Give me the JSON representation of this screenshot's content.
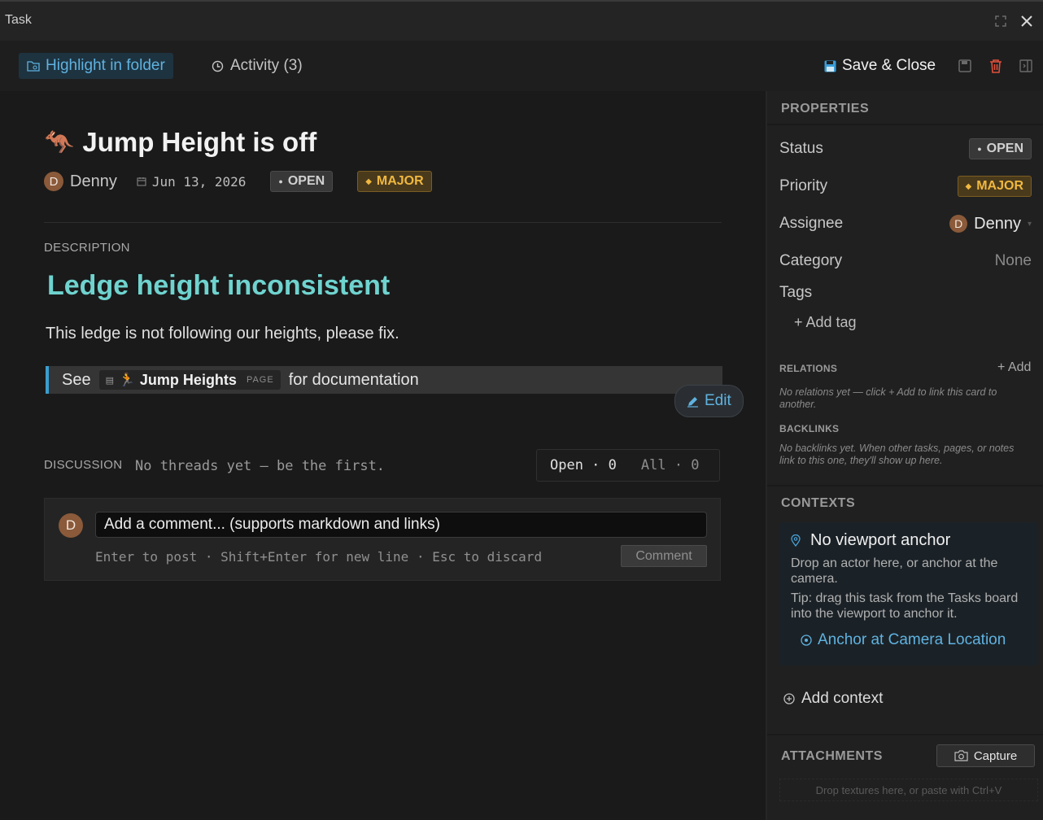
{
  "window": {
    "title": "Task"
  },
  "toolbar": {
    "highlight_label": "Highlight in folder",
    "activity_label": "Activity (3)",
    "save_close_label": "Save & Close"
  },
  "task": {
    "emoji": "🦘",
    "title": "Jump Height is off",
    "author_initial": "D",
    "author": "Denny",
    "date": "Jun 13, 2026",
    "status": "OPEN",
    "priority": "MAJOR"
  },
  "description": {
    "label": "DESCRIPTION",
    "heading": "Ledge height inconsistent",
    "text": "This ledge is not following our heights, please fix.",
    "callout_prefix": "See",
    "page_emoji": "🏃",
    "page_name": "Jump Heights",
    "page_tag": "PAGE",
    "callout_suffix": "for documentation",
    "edit_label": "Edit"
  },
  "discussion": {
    "label": "DISCUSSION",
    "empty_text": "No threads yet — be the first.",
    "filter_open": "Open · 0",
    "filter_all": "All · 0",
    "comment_placeholder": "Add a comment... (supports markdown and links)",
    "hint": "Enter to post · Shift+Enter for new line · Esc to discard",
    "comment_button": "Comment",
    "avatar_initial": "D"
  },
  "properties": {
    "header": "PROPERTIES",
    "status_label": "Status",
    "status_value": "OPEN",
    "priority_label": "Priority",
    "priority_value": "MAJOR",
    "assignee_label": "Assignee",
    "assignee_initial": "D",
    "assignee_value": "Denny",
    "category_label": "Category",
    "category_value": "None",
    "tags_label": "Tags",
    "add_tag": "+ Add tag",
    "relations_header": "RELATIONS",
    "relations_add": "+ Add",
    "relations_empty": "No relations yet — click + Add to link this card to another.",
    "backlinks_header": "BACKLINKS",
    "backlinks_empty": "No backlinks yet. When other tasks, pages, or notes link to this one, they'll show up here."
  },
  "contexts": {
    "header": "CONTEXTS",
    "title": "No viewport anchor",
    "text1": "Drop an actor here, or anchor at the camera.",
    "text2": "Tip: drag this task from the Tasks board into the viewport to anchor it.",
    "anchor_button": "Anchor at Camera Location",
    "add_context": "Add context"
  },
  "attachments": {
    "header": "ATTACHMENTS",
    "capture": "Capture",
    "drop_hint": "Drop textures here, or paste with Ctrl+V"
  },
  "colors": {
    "accent_blue": "#5fb2e0",
    "heading_teal": "#6fd3cf",
    "major_orange": "#f0b840",
    "delete_red": "#e0503c"
  }
}
